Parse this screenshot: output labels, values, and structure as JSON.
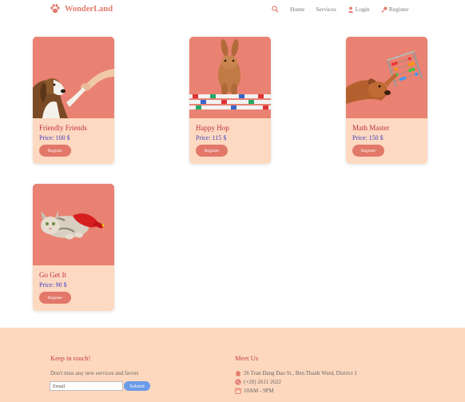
{
  "brand": {
    "name": "WonderLand",
    "logo_icon": "paw-icon",
    "color": "#e27b6d"
  },
  "nav": {
    "search_icon": "search-icon",
    "home": "Home",
    "services": "Services",
    "login": "Login",
    "register": "Register"
  },
  "cards": [
    {
      "title": "Friendly Friends",
      "price": "Price: 100 $",
      "button": "Register",
      "image": "beagle-high-five-photo"
    },
    {
      "title": "Happy Hop",
      "price": "Price: 115 $",
      "button": "Register",
      "image": "rabbit-jumping-photo"
    },
    {
      "title": "Math Master",
      "price": "Price: 150 $",
      "button": "Register",
      "image": "dog-abacus-photo"
    },
    {
      "title": "Go Get It",
      "price": "Price: 90 $",
      "button": "Register",
      "image": "kitten-toy-photo"
    }
  ],
  "footer": {
    "newsletter_heading": "Keep in touch!",
    "newsletter_desc": "Don't miss any new services and favors",
    "email_value": "Email",
    "submit": "Submit",
    "meet_heading": "Meet Us",
    "address": "26 Tran Dang Dao St., Ben Thanh Ward, District 1",
    "phone": "(+20) 2611 2622",
    "hours": "10AM - 9PM"
  },
  "colors": {
    "accent": "#e27b6d",
    "card_bg": "#fdd9c1",
    "photo_bg": "#e98272",
    "footer_bg": "#fdd8be",
    "submit_blue": "#6b9ae8"
  }
}
